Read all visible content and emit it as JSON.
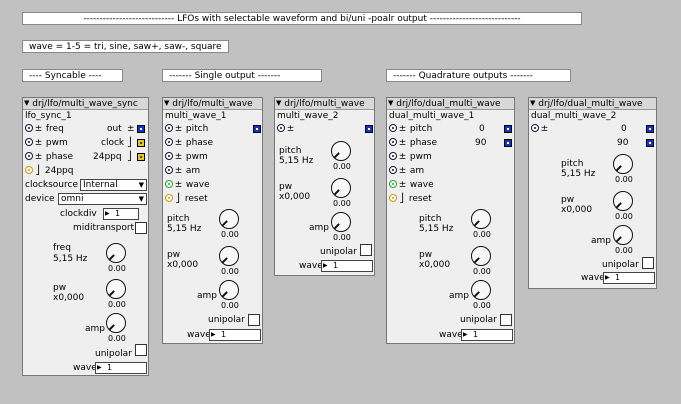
{
  "title_label": "---------------------------- LFOs with selectable waveform and bi/uni -poalr output ----------------------------",
  "wave_label": "wave = 1-5 = tri, sine, saw+, saw-, square",
  "section_syncable": "---- Syncable ----",
  "section_single": "------- Single output -------",
  "section_quad": "------- Quadrature outputs -------",
  "colors": {
    "background": "#c1c1c1",
    "inlet_blue": "#1432c8",
    "inlet_yellow": "#e6c62a",
    "inlet_green": "#22aa22"
  },
  "sync": {
    "header": "drj/lfo/multi_wave_sync",
    "name": "lfo_sync_1",
    "freq": "freq",
    "pwm": "pwm",
    "phase": "phase",
    "ppq_in": "24ppq",
    "out": "out",
    "clock": "clock",
    "ppq_out": "24ppq",
    "clocksource_label": "clocksource",
    "clocksource_value": "Internal",
    "device_label": "device",
    "device_value": "omni",
    "clockdiv_label": "clockdiv",
    "clockdiv_value": "1",
    "miditransport": "miditransport",
    "freq_label": "freq",
    "freq_value": "5,15 Hz",
    "freq_knob": "0.00",
    "pw_label": "pw",
    "pw_value": "x0,000",
    "pw_knob": "0.00",
    "amp_label": "amp",
    "amp_knob": "0.00",
    "unipolar": "unipolar",
    "wave_label": "wave",
    "wave_value": "1"
  },
  "single1": {
    "header": "drj/lfo/multi_wave",
    "name": "multi_wave_1",
    "pitch": "pitch",
    "phase": "phase",
    "pwm": "pwm",
    "am": "am",
    "wave_in": "wave",
    "reset": "reset",
    "pitch_label": "pitch",
    "pitch_value": "5,15 Hz",
    "pitch_knob": "0.00",
    "pw_label": "pw",
    "pw_value": "x0,000",
    "pw_knob": "0.00",
    "amp_label": "amp",
    "amp_knob": "0.00",
    "unipolar": "unipolar",
    "wave_label": "wave",
    "wave_value": "1"
  },
  "single2": {
    "header": "drj/lfo/multi_wave",
    "name": "multi_wave_2",
    "pitch_label": "pitch",
    "pitch_value": "5,15 Hz",
    "pitch_knob": "0.00",
    "pw_label": "pw",
    "pw_value": "x0,000",
    "pw_knob": "0.00",
    "amp_label": "amp",
    "amp_knob": "0.00",
    "unipolar": "unipolar",
    "wave_label": "wave",
    "wave_value": "1"
  },
  "dual1": {
    "header": "drj/lfo/dual_multi_wave",
    "name": "dual_multi_wave_1",
    "pitch": "pitch",
    "phase": "phase",
    "pwm": "pwm",
    "am": "am",
    "wave_in": "wave",
    "reset": "reset",
    "out1": "0",
    "out2": "90",
    "pitch_label": "pitch",
    "pitch_value": "5,15 Hz",
    "pitch_knob": "0.00",
    "pw_label": "pw",
    "pw_value": "x0,000",
    "pw_knob": "0.00",
    "amp_label": "amp",
    "amp_knob": "0.00",
    "unipolar": "unipolar",
    "wave_label": "wave",
    "wave_value": "1"
  },
  "dual2": {
    "header": "drj/lfo/dual_multi_wave",
    "name": "dual_multi_wave_2",
    "out1": "0",
    "out2": "90",
    "pitch_label": "pitch",
    "pitch_value": "5,15 Hz",
    "pitch_knob": "0.00",
    "pw_label": "pw",
    "pw_value": "x0,000",
    "pw_knob": "0.00",
    "amp_label": "amp",
    "amp_knob": "0.00",
    "unipolar": "unipolar",
    "wave_label": "wave",
    "wave_value": "1"
  }
}
